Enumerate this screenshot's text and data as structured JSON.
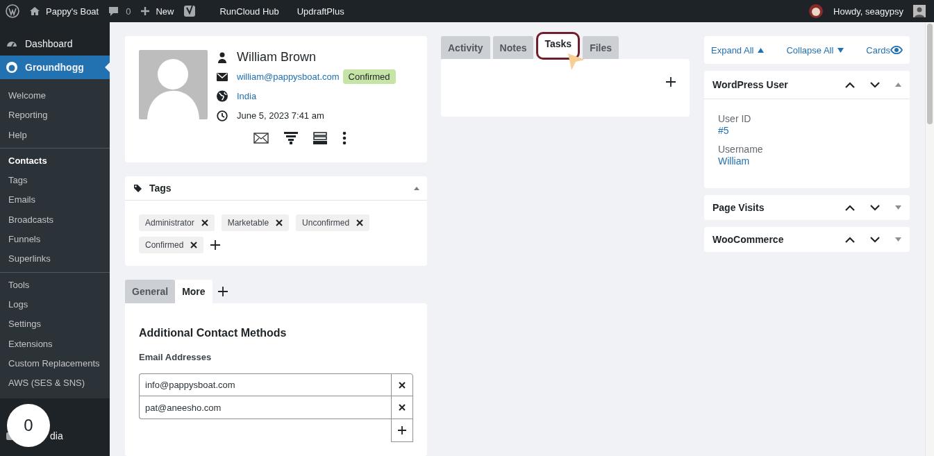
{
  "admin_bar": {
    "site": "Pappy's Boat",
    "comments": "0",
    "new": "New",
    "links": [
      "RunCloud Hub",
      "UpdraftPlus"
    ],
    "greeting": "Howdy, seagypsy"
  },
  "sidebar": {
    "menus": [
      {
        "label": "Dashboard",
        "selected": false
      },
      {
        "label": "Groundhogg",
        "selected": true
      }
    ],
    "groups": [
      [
        {
          "label": "Welcome",
          "selected": false
        },
        {
          "label": "Reporting",
          "selected": false
        },
        {
          "label": "Help",
          "selected": false
        }
      ],
      [
        {
          "label": "Contacts",
          "selected": true
        },
        {
          "label": "Tags",
          "selected": false
        },
        {
          "label": "Emails",
          "selected": false
        },
        {
          "label": "Broadcasts",
          "selected": false
        },
        {
          "label": "Funnels",
          "selected": false
        },
        {
          "label": "Superlinks",
          "selected": false
        }
      ],
      [
        {
          "label": "Tools",
          "selected": false
        },
        {
          "label": "Logs",
          "selected": false
        },
        {
          "label": "Settings",
          "selected": false
        },
        {
          "label": "Extensions",
          "selected": false
        },
        {
          "label": "Custom Replacements",
          "selected": false
        },
        {
          "label": "AWS (SES & SNS)",
          "selected": false
        }
      ]
    ],
    "bottom": "dia"
  },
  "badge": "0",
  "contact": {
    "name": "William Brown",
    "email": "william@pappysboat.com",
    "status": "Confirmed",
    "country": "India",
    "date": "June 5, 2023 7:41 am"
  },
  "tags_panel": {
    "title": "Tags",
    "expanded": true,
    "tags": [
      "Administrator",
      "Marketable",
      "Unconfirmed",
      "Confirmed"
    ]
  },
  "info_tabs": [
    {
      "label": "General",
      "selected": false
    },
    {
      "label": "More",
      "selected": true
    }
  ],
  "info": {
    "title": "Additional Contact Methods",
    "field_label": "Email Addresses",
    "emails": [
      "info@pappysboat.com",
      "pat@aneesho.com"
    ]
  },
  "activity_tabs": [
    {
      "label": "Activity",
      "selected": false
    },
    {
      "label": "Notes",
      "selected": false
    },
    {
      "label": "Tasks",
      "selected": true
    },
    {
      "label": "Files",
      "selected": false
    }
  ],
  "controls": [
    "Expand All",
    "Collapse All",
    "Cards"
  ],
  "cards": [
    {
      "title": "WordPress User",
      "expanded": true,
      "fields": [
        {
          "label": "User ID",
          "value": "#5"
        },
        {
          "label": "Username",
          "value": "William"
        }
      ]
    },
    {
      "title": "Page Visits",
      "expanded": false
    },
    {
      "title": "WooCommerce",
      "expanded": false
    }
  ]
}
